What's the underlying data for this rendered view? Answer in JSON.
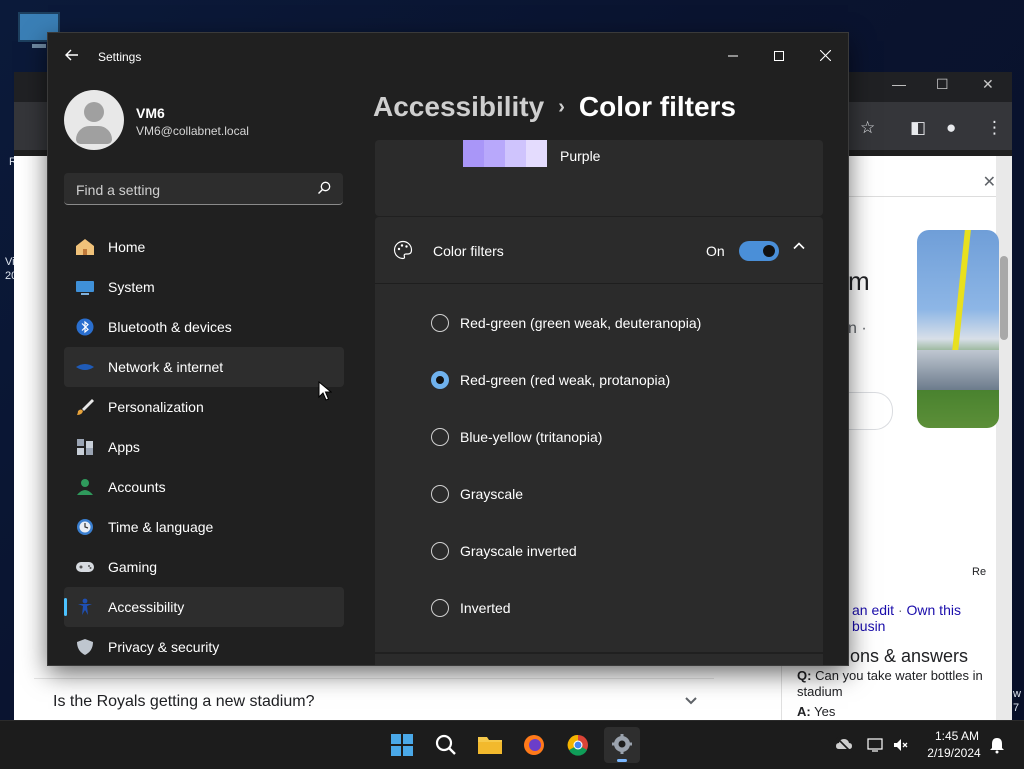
{
  "desktop": {
    "edge_texts": [
      "R",
      "Vi",
      "20",
      "w",
      "7"
    ]
  },
  "browser": {
    "question": "Is the Royals getting a new stadium?",
    "partial_heading": "m",
    "partial_sub": "n ·",
    "links_row": {
      "edit_link": "an edit",
      "separator": "·",
      "own_link": "Own this busin"
    },
    "corner_label": "Re",
    "qa_heading": "ons & answers",
    "qa_q_label": "Q:",
    "qa_q_text": "Can you take water bottles in",
    "qa_q_text2": "stadium",
    "qa_a_label": "A:",
    "qa_a_text": "Yes"
  },
  "settings": {
    "window_title": "Settings",
    "profile": {
      "name": "VM6",
      "email": "VM6@collabnet.local"
    },
    "search": {
      "placeholder": "Find a setting"
    },
    "nav": [
      {
        "label": "Home",
        "icon": "home-icon"
      },
      {
        "label": "System",
        "icon": "system-icon"
      },
      {
        "label": "Bluetooth & devices",
        "icon": "bluetooth-icon"
      },
      {
        "label": "Network & internet",
        "icon": "network-icon"
      },
      {
        "label": "Personalization",
        "icon": "brush-icon"
      },
      {
        "label": "Apps",
        "icon": "apps-icon"
      },
      {
        "label": "Accounts",
        "icon": "accounts-icon"
      },
      {
        "label": "Time & language",
        "icon": "clock-icon"
      },
      {
        "label": "Gaming",
        "icon": "gamepad-icon"
      },
      {
        "label": "Accessibility",
        "icon": "accessibility-icon"
      },
      {
        "label": "Privacy & security",
        "icon": "shield-icon"
      }
    ],
    "breadcrumb": {
      "parent": "Accessibility",
      "separator": "›",
      "current": "Color filters"
    },
    "swatch": {
      "label": "Purple",
      "colors": [
        "#a996f8",
        "#b8a8fb",
        "#cfc4fd",
        "#e4dcfe"
      ]
    },
    "color_filters": {
      "title": "Color filters",
      "state": "On",
      "options": [
        {
          "label": "Red-green (green weak, deuteranopia)",
          "selected": false
        },
        {
          "label": "Red-green (red weak, protanopia)",
          "selected": true
        },
        {
          "label": "Blue-yellow (tritanopia)",
          "selected": false
        },
        {
          "label": "Grayscale",
          "selected": false
        },
        {
          "label": "Grayscale inverted",
          "selected": false
        },
        {
          "label": "Inverted",
          "selected": false
        }
      ]
    }
  },
  "taskbar": {
    "time": "1:45 AM",
    "date": "2/19/2024"
  },
  "colors": {
    "accent": "#4cc2ff",
    "toggle_on": "#4a8fd8",
    "window_bg": "#202020",
    "card_bg": "#2b2b2b"
  }
}
